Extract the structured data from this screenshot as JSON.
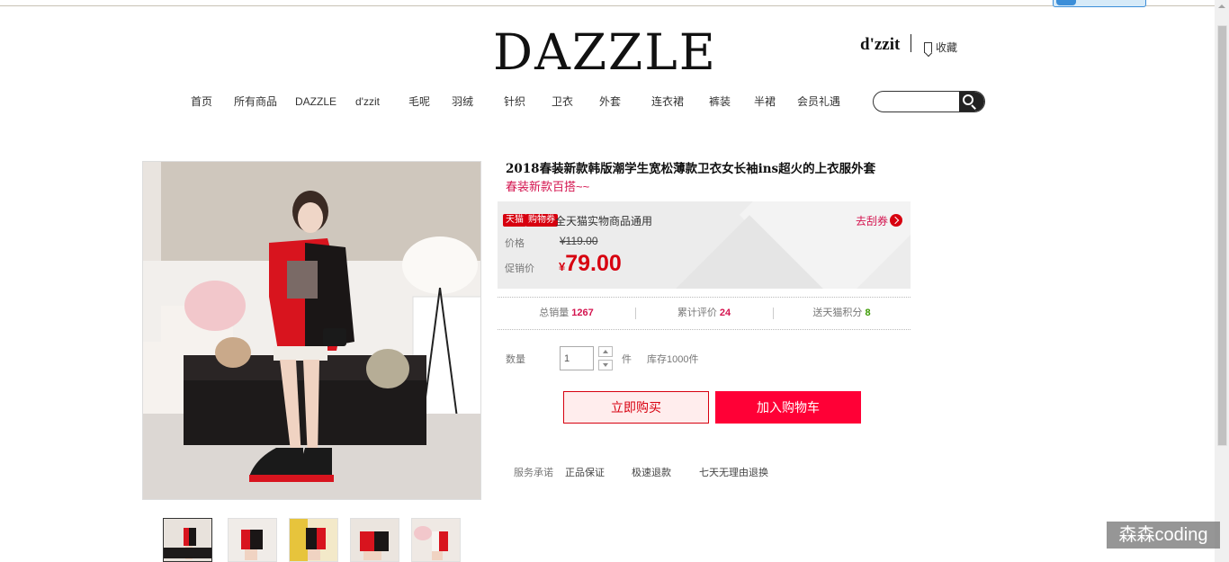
{
  "header": {
    "logo": "DAZZLE",
    "brand2": "d'zzit",
    "favorite_label": "收藏"
  },
  "nav": {
    "items": [
      "首页",
      "所有商品",
      "DAZZLE",
      "d'zzit",
      "毛呢",
      "羽绒",
      "针织",
      "卫衣",
      "外套",
      "连衣裙",
      "裤装",
      "半裙",
      "会员礼遇"
    ]
  },
  "search": {
    "placeholder": ""
  },
  "product": {
    "title": "2018春装新款韩版潮学生宽松薄款卫衣女长袖ins超火的上衣服外套",
    "subtitle": "春装新款百搭~~",
    "tag_tmall": "天猫",
    "tag_coupon": "购物券",
    "coupon_text": "全天猫实物商品通用",
    "get_coupon": "去刮券",
    "price_label": "价格",
    "original_price": "¥119.00",
    "promo_label": "促销价",
    "currency": "¥",
    "promo_price": "79.00",
    "stats": [
      {
        "label": "总销量",
        "value": "1267"
      },
      {
        "label": "累计评价",
        "value": "24"
      },
      {
        "label": "送天猫积分",
        "value": "8"
      }
    ],
    "quantity_label": "数量",
    "quantity_value": "1",
    "unit": "件",
    "stock": "库存1000件",
    "buy_now": "立即购买",
    "add_to_cart": "加入购物车",
    "service_label": "服务承诺",
    "services": [
      "正品保证",
      "极速退款",
      "七天无理由退换"
    ]
  },
  "watermark": "森森coding",
  "colors": {
    "accent_red": "#ff0036",
    "price_red": "#d7000f",
    "pink_text": "#d4144f",
    "green": "#3a9a00"
  }
}
